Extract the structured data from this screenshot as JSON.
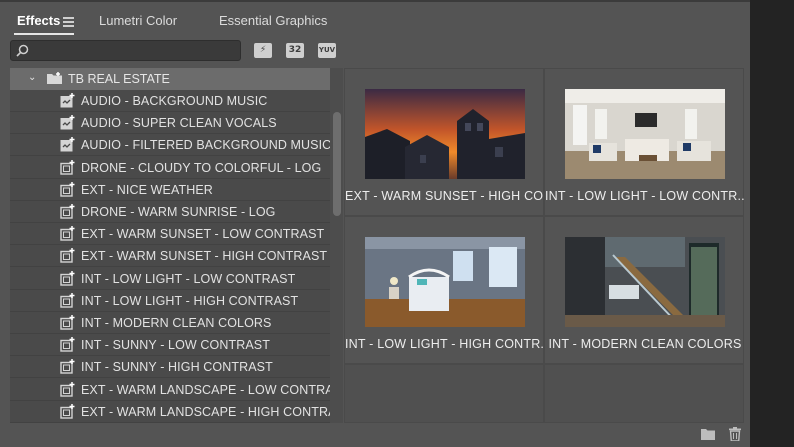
{
  "tabs": [
    {
      "label": "Effects",
      "active": true
    },
    {
      "label": "Lumetri Color",
      "active": false
    },
    {
      "label": "Essential Graphics",
      "active": false
    }
  ],
  "search": {
    "value": "",
    "placeholder": ""
  },
  "toolbar": {
    "accelerated_label": "⚡",
    "bit32_label": "32",
    "yuv_label": "YUV"
  },
  "tree": {
    "folder": "TB REAL ESTATE",
    "items": [
      {
        "label": "AUDIO - BACKGROUND MUSIC",
        "icon": "audio-preset-icon"
      },
      {
        "label": "AUDIO - SUPER CLEAN VOCALS",
        "icon": "audio-preset-icon"
      },
      {
        "label": "AUDIO - FILTERED BACKGROUND MUSIC",
        "icon": "audio-preset-icon"
      },
      {
        "label": "DRONE - CLOUDY TO COLORFUL - LOG",
        "icon": "video-preset-icon"
      },
      {
        "label": "EXT - NICE WEATHER",
        "icon": "video-preset-icon"
      },
      {
        "label": "DRONE - WARM SUNRISE - LOG",
        "icon": "video-preset-icon"
      },
      {
        "label": "EXT - WARM SUNSET - LOW CONTRAST",
        "icon": "video-preset-icon"
      },
      {
        "label": "EXT - WARM SUNSET - HIGH CONTRAST",
        "icon": "video-preset-icon"
      },
      {
        "label": "INT - LOW LIGHT - LOW CONTRAST",
        "icon": "video-preset-icon"
      },
      {
        "label": "INT - LOW LIGHT - HIGH CONTRAST",
        "icon": "video-preset-icon"
      },
      {
        "label": "INT - MODERN CLEAN COLORS",
        "icon": "video-preset-icon"
      },
      {
        "label": "INT - SUNNY - LOW CONTRAST",
        "icon": "video-preset-icon"
      },
      {
        "label": "INT - SUNNY - HIGH CONTRAST",
        "icon": "video-preset-icon"
      },
      {
        "label": "EXT - WARM LANDSCAPE - LOW CONTRAST",
        "icon": "video-preset-icon"
      },
      {
        "label": "EXT - WARM LANDSCAPE - HIGH CONTRAST",
        "icon": "video-preset-icon"
      }
    ]
  },
  "thumbnails": [
    {
      "label": "EXT - WARM SUNSET - HIGH CO...",
      "scene": "sunset-house"
    },
    {
      "label": "INT - LOW LIGHT - LOW CONTR...",
      "scene": "living-room"
    },
    {
      "label": "INT - LOW LIGHT - HIGH CONTR...",
      "scene": "bedroom"
    },
    {
      "label": "INT - MODERN CLEAN COLORS",
      "scene": "staircase"
    }
  ],
  "bottom_icons": [
    "new-bin-icon",
    "delete-icon"
  ],
  "colors": {
    "panel": "#545454",
    "list_bg": "#4a4a4a",
    "folder_row": "#6c6c6c",
    "accent_text": "#ffffff"
  }
}
